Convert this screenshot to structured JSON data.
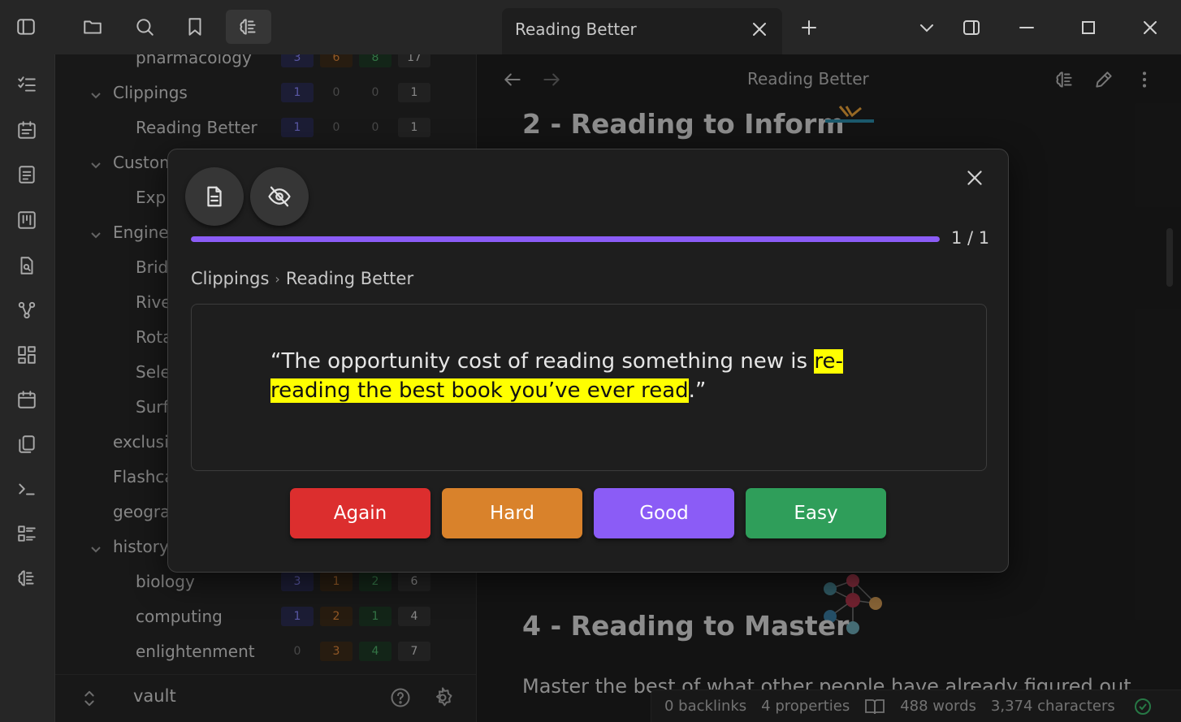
{
  "titlebar": {
    "tab_title": "Reading Better"
  },
  "sidebar": {
    "rows": [
      {
        "label": "pharmacology",
        "indent": 2,
        "chevron": false,
        "counts": [
          "3",
          "6",
          "8",
          "17"
        ],
        "kinds": [
          "new",
          "learn",
          "due",
          "total"
        ]
      },
      {
        "label": "Clippings",
        "indent": 1,
        "chevron": true,
        "counts": [
          "1",
          "0",
          "0",
          "1"
        ],
        "kinds": [
          "new",
          "zero",
          "zero",
          "total"
        ]
      },
      {
        "label": "Reading Better",
        "indent": 2,
        "chevron": false,
        "counts": [
          "1",
          "0",
          "0",
          "1"
        ],
        "kinds": [
          "new",
          "zero",
          "zero",
          "total"
        ]
      },
      {
        "label": "Custom",
        "indent": 1,
        "chevron": true,
        "counts": [],
        "kinds": []
      },
      {
        "label": "Exp",
        "indent": 2,
        "chevron": false,
        "counts": [],
        "kinds": []
      },
      {
        "label": "Engine",
        "indent": 1,
        "chevron": true,
        "counts": [],
        "kinds": []
      },
      {
        "label": "Brid",
        "indent": 2,
        "chevron": false,
        "counts": [],
        "kinds": []
      },
      {
        "label": "Rive",
        "indent": 2,
        "chevron": false,
        "counts": [],
        "kinds": []
      },
      {
        "label": "Rota",
        "indent": 2,
        "chevron": false,
        "counts": [],
        "kinds": []
      },
      {
        "label": "Sele",
        "indent": 2,
        "chevron": false,
        "counts": [],
        "kinds": []
      },
      {
        "label": "Surf",
        "indent": 2,
        "chevron": false,
        "counts": [],
        "kinds": []
      },
      {
        "label": "exclusi",
        "indent": 1,
        "chevron": false,
        "counts": [],
        "kinds": []
      },
      {
        "label": "Flashca",
        "indent": 1,
        "chevron": false,
        "counts": [],
        "kinds": []
      },
      {
        "label": "geogra",
        "indent": 1,
        "chevron": false,
        "counts": [],
        "kinds": []
      },
      {
        "label": "history",
        "indent": 1,
        "chevron": true,
        "counts": [],
        "kinds": []
      },
      {
        "label": "biology",
        "indent": 2,
        "chevron": false,
        "counts": [
          "3",
          "1",
          "2",
          "6"
        ],
        "kinds": [
          "new",
          "learn",
          "due",
          "total"
        ]
      },
      {
        "label": "computing",
        "indent": 2,
        "chevron": false,
        "counts": [
          "1",
          "2",
          "1",
          "4"
        ],
        "kinds": [
          "new",
          "learn",
          "due",
          "total"
        ]
      },
      {
        "label": "enlightenment",
        "indent": 2,
        "chevron": false,
        "counts": [
          "0",
          "3",
          "4",
          "7"
        ],
        "kinds": [
          "zero",
          "learn",
          "due",
          "total"
        ]
      }
    ],
    "vault_name": "vault"
  },
  "main": {
    "nav_title": "Reading Better",
    "heading_2": "2 - Reading to Inform",
    "heading_4": "4 - Reading to Master",
    "paragraph": "Master the best of what other people have already figured out"
  },
  "statusbar": {
    "backlinks": "0 backlinks",
    "properties": "4 properties",
    "words": "488 words",
    "characters": "3,374 characters"
  },
  "modal": {
    "progress_value": 1.0,
    "progress_text": "1 / 1",
    "crumb_1": "Clippings",
    "crumb_sep": "›",
    "crumb_2": "Reading Better",
    "card_text_1": "“The opportunity cost of reading something new is ",
    "card_highlight": "re-reading the best book you’ve ever read",
    "card_text_2": ".”",
    "buttons": [
      {
        "label": "Again",
        "color": "#dc2e2e"
      },
      {
        "label": "Hard",
        "color": "#d9822b"
      },
      {
        "label": "Good",
        "color": "#8b5cf6"
      },
      {
        "label": "Easy",
        "color": "#2f9e5a"
      }
    ]
  },
  "colors": {
    "accent": "#8b5cf6",
    "highlight": "#ffff00"
  }
}
